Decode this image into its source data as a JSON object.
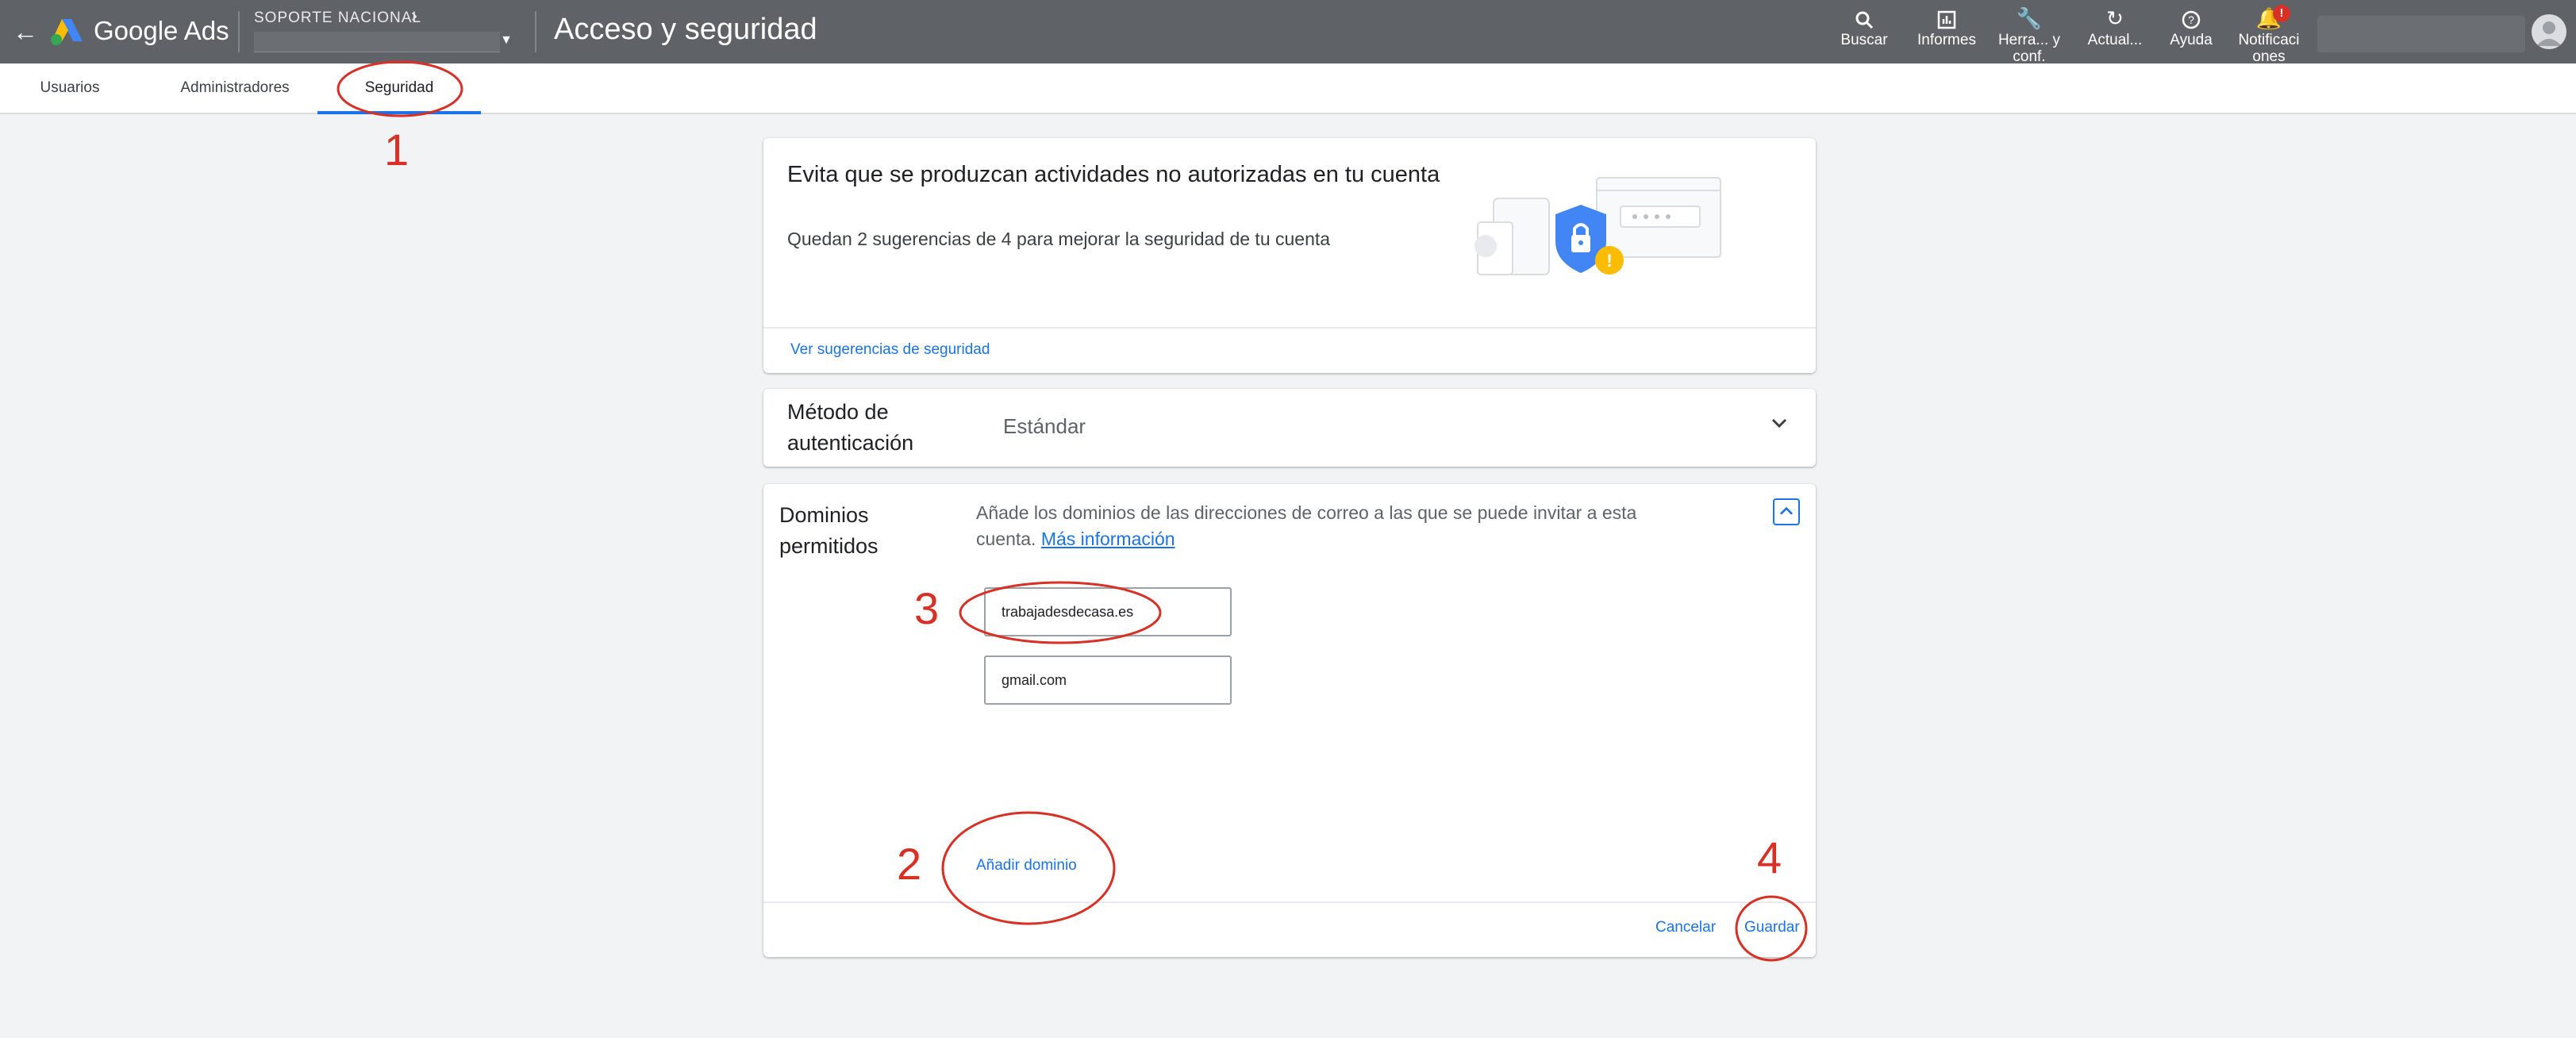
{
  "topbar": {
    "brand": "Google Ads",
    "account_name": "SOPORTE NACIONAL",
    "title": "Acceso y seguridad",
    "tools": [
      {
        "label": "Buscar",
        "icon": "search-icon"
      },
      {
        "label": "Informes",
        "icon": "reports-icon"
      },
      {
        "label": "Herra... y conf.",
        "icon": "wrench-icon"
      },
      {
        "label": "Actual...",
        "icon": "refresh-icon"
      },
      {
        "label": "Ayuda",
        "icon": "help-icon"
      },
      {
        "label": "Notificaci ones",
        "icon": "bell-icon"
      }
    ],
    "notification_badge": "!"
  },
  "tabs": [
    {
      "label": "Usuarios"
    },
    {
      "label": "Administradores"
    },
    {
      "label": "Seguridad",
      "active": true
    }
  ],
  "security_card": {
    "heading": "Evita que se produzcan actividades no autorizadas en tu cuenta",
    "text": "Quedan 2 sugerencias de 4 para mejorar la seguridad de tu cuenta",
    "link": "Ver sugerencias de seguridad"
  },
  "auth_card": {
    "label": "Método de autenticación",
    "value": "Estándar"
  },
  "domains_card": {
    "label": "Dominios permitidos",
    "description": "Añade los dominios de las direcciones de correo a las que se puede invitar a esta cuenta.",
    "more_info": "Más información",
    "domains": [
      "trabajadesdecasa.es",
      "gmail.com"
    ],
    "add_label": "Añadir dominio",
    "cancel_label": "Cancelar",
    "save_label": "Guardar"
  },
  "annotations": [
    "1",
    "2",
    "3",
    "4"
  ],
  "colors": {
    "topbar": "#5f6368",
    "accent": "#1a73e8",
    "annotation": "#d93025"
  }
}
